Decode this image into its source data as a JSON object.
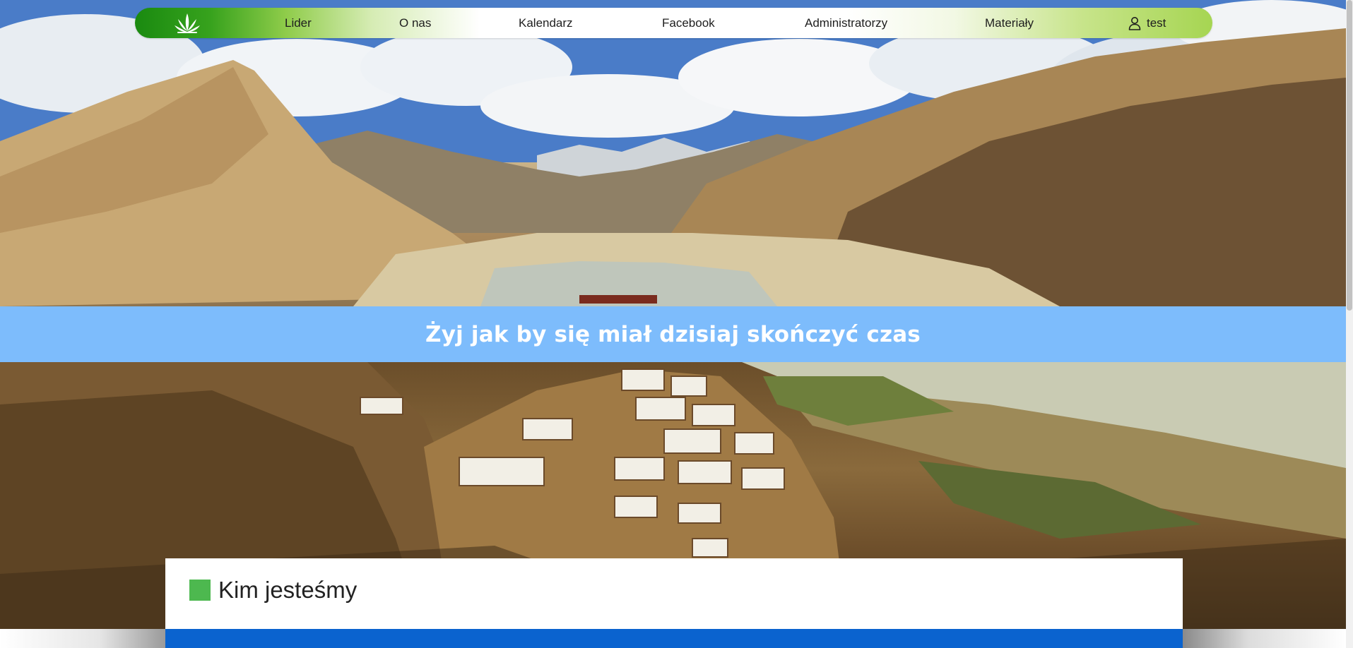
{
  "nav": {
    "items": [
      {
        "label": "Lider"
      },
      {
        "label": "O nas"
      },
      {
        "label": "Kalendarz"
      },
      {
        "label": "Facebook"
      },
      {
        "label": "Administratorzy"
      },
      {
        "label": "Materiały"
      }
    ],
    "user": {
      "label": "test",
      "icon": "user-icon"
    },
    "logo_icon": "lotus-icon"
  },
  "banner": {
    "text": "Żyj jak by się miał dzisiaj skończyć czas"
  },
  "section": {
    "title": "Kim jesteśmy"
  },
  "colors": {
    "nav_green_dark": "#1a8a10",
    "nav_green_light": "#a6d552",
    "banner_blue": "#7dbcfc",
    "title_square_green": "#4db84f",
    "card_blue": "#0a63cf"
  }
}
